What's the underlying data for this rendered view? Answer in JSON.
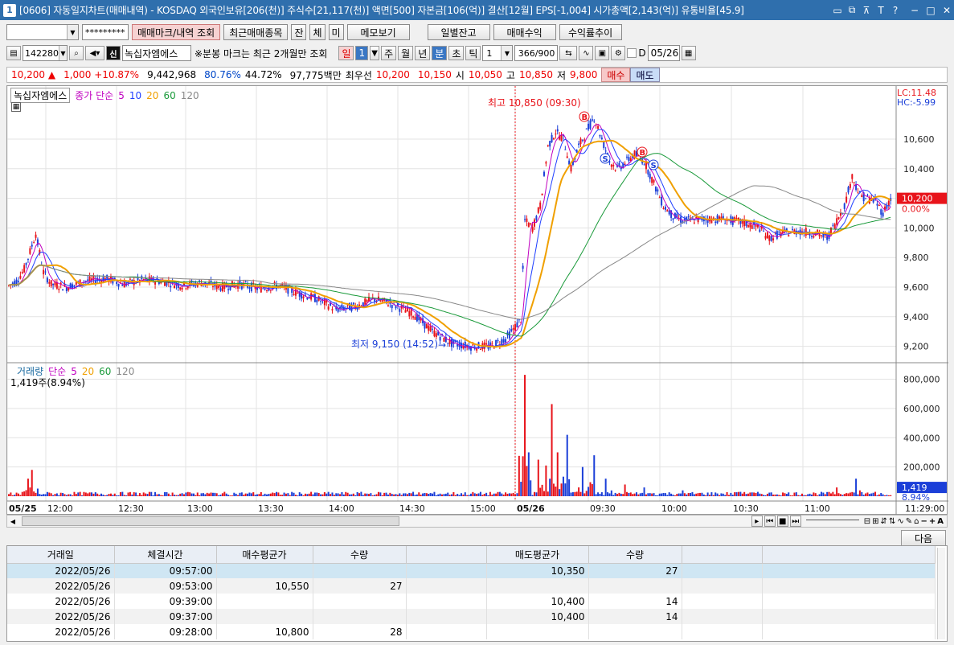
{
  "window": {
    "number": "1",
    "title": "[0606] 자동일지차트(매매내역) - KOSDAQ 외국인보유[206(천)] 주식수[21,117(천)] 액면[500] 자본금[106(억)] 결산[12월] EPS[-1,004] 시가총액[2,143(억)] 유통비율[45.9]",
    "title_icons": [
      "▭",
      "⧉",
      "⊼",
      "T",
      "?"
    ],
    "controls": [
      "−",
      "□",
      "✕"
    ]
  },
  "toolbar1": {
    "account_value": "",
    "password_value": "*********",
    "buttons": [
      "매매마크/내역 조회",
      "최근매매종목",
      "잔",
      "체",
      "미",
      "메모보기",
      "일별잔고",
      "매매수익",
      "수익률추이"
    ]
  },
  "toolbar2": {
    "code": "142280",
    "stock_name": "녹십자엠에스",
    "mark_badge": "신",
    "notice": "※분봉 마크는 최근 2개월만 조회",
    "period_buttons": [
      "일",
      "주",
      "월",
      "년",
      "분",
      "초",
      "틱"
    ],
    "day_value": "1",
    "minute_value": "1",
    "count": "366/900",
    "date_prefix": "D",
    "date": "05/26"
  },
  "quote": {
    "price": "10,200",
    "arrow": "▲",
    "change": "1,000",
    "change_pct": "+10.87%",
    "volume": "9,442,968",
    "pct1": "80.76%",
    "pct2": "44.72%",
    "amount": "97,775백만",
    "best_label": "최우선",
    "best_ask": "10,200",
    "best_bid": "10,150",
    "open_label": "시",
    "open": "10,050",
    "high_label": "고",
    "high": "10,850",
    "low_label": "저",
    "low": "9,800",
    "buy_btn": "매수",
    "sell_btn": "매도"
  },
  "chart_data": {
    "type": "candlestick",
    "price_legend": {
      "name": "녹십자엠에스",
      "ma_label": "종가 단순",
      "periods": [
        "5",
        "10",
        "20",
        "60",
        "120"
      ]
    },
    "volume_legend": {
      "name": "거래량",
      "ma_label": "단순",
      "periods": [
        "5",
        "20",
        "60",
        "120"
      ],
      "current": "1,419주(8.94%)"
    },
    "price_axis": [
      "10,600",
      "10,400",
      "10,200",
      "10,000",
      "9,800",
      "9,600",
      "9,400",
      "9,200"
    ],
    "price_range": [
      9100,
      10850
    ],
    "volume_axis": [
      "800,000",
      "600,000",
      "400,000",
      "200,000"
    ],
    "volume_range": [
      0,
      880000
    ],
    "lc": "LC:11.48",
    "hc": "HC:-5.99",
    "current_price_tag": "10,200",
    "current_pct_tag": "0.00%",
    "current_vol_tag": "1,419",
    "current_vol_pct_tag": "8.94%",
    "high_annotation": "최고 10,850 (09:30)",
    "low_annotation": "최저 9,150 (14:52)",
    "x_labels": [
      "05/25",
      "12:00",
      "12:30",
      "13:00",
      "13:30",
      "14:00",
      "14:30",
      "15:00",
      "05/26",
      "09:30",
      "10:00",
      "10:30",
      "11:00"
    ],
    "x_end_label": "11:29:00",
    "markers": [
      "B",
      "S",
      "B",
      "S"
    ],
    "price_path_points": [
      [
        0,
        9610
      ],
      [
        4,
        9640
      ],
      [
        8,
        9720
      ],
      [
        12,
        9880
      ],
      [
        14,
        9960
      ],
      [
        18,
        9700
      ],
      [
        22,
        9620
      ],
      [
        30,
        9600
      ],
      [
        40,
        9640
      ],
      [
        50,
        9660
      ],
      [
        60,
        9620
      ],
      [
        70,
        9650
      ],
      [
        80,
        9640
      ],
      [
        90,
        9610
      ],
      [
        100,
        9630
      ],
      [
        110,
        9600
      ],
      [
        120,
        9620
      ],
      [
        130,
        9590
      ],
      [
        140,
        9610
      ],
      [
        150,
        9560
      ],
      [
        160,
        9520
      ],
      [
        170,
        9450
      ],
      [
        180,
        9470
      ],
      [
        190,
        9520
      ],
      [
        200,
        9480
      ],
      [
        210,
        9420
      ],
      [
        220,
        9300
      ],
      [
        230,
        9220
      ],
      [
        240,
        9200
      ],
      [
        250,
        9200
      ],
      [
        258,
        9250
      ],
      [
        266,
        9380
      ],
      [
        268,
        10050
      ],
      [
        272,
        10000
      ],
      [
        276,
        10150
      ],
      [
        280,
        10550
      ],
      [
        284,
        10650
      ],
      [
        288,
        10600
      ],
      [
        292,
        10400
      ],
      [
        296,
        10550
      ],
      [
        300,
        10650
      ],
      [
        304,
        10750
      ],
      [
        308,
        10600
      ],
      [
        312,
        10450
      ],
      [
        316,
        10400
      ],
      [
        320,
        10440
      ],
      [
        325,
        10500
      ],
      [
        330,
        10450
      ],
      [
        335,
        10300
      ],
      [
        340,
        10150
      ],
      [
        345,
        10080
      ],
      [
        350,
        10050
      ],
      [
        360,
        10060
      ],
      [
        370,
        10060
      ],
      [
        380,
        10040
      ],
      [
        390,
        10000
      ],
      [
        395,
        9930
      ],
      [
        400,
        9960
      ],
      [
        410,
        9980
      ],
      [
        420,
        9960
      ],
      [
        425,
        9930
      ],
      [
        430,
        10050
      ],
      [
        434,
        10150
      ],
      [
        438,
        10350
      ],
      [
        442,
        10220
      ],
      [
        446,
        10200
      ],
      [
        450,
        10180
      ],
      [
        454,
        10100
      ],
      [
        458,
        10200
      ]
    ],
    "volume_spikes": [
      [
        10,
        120000
      ],
      [
        12,
        180000
      ],
      [
        100,
        20000
      ],
      [
        210,
        30000
      ],
      [
        266,
        60000
      ],
      [
        268,
        830000
      ],
      [
        270,
        300000
      ],
      [
        275,
        250000
      ],
      [
        282,
        630000
      ],
      [
        285,
        300000
      ],
      [
        290,
        420000
      ],
      [
        298,
        200000
      ],
      [
        304,
        280000
      ],
      [
        310,
        120000
      ],
      [
        320,
        80000
      ],
      [
        330,
        60000
      ],
      [
        350,
        40000
      ],
      [
        380,
        30000
      ],
      [
        430,
        60000
      ],
      [
        440,
        120000
      ],
      [
        450,
        30000
      ]
    ]
  },
  "bottom_toolbar": {
    "icons": [
      "▸",
      "⏮",
      "■",
      "⏭",
      "⊟",
      "⊞",
      "⇵",
      "⇅",
      "∿",
      "✎",
      "⌂",
      "−",
      "+",
      "A"
    ]
  },
  "trades": {
    "next_btn": "다음",
    "headers": [
      "거래일",
      "체결시간",
      "매수평균가",
      "수량",
      "",
      "매도평균가",
      "수량",
      "",
      ""
    ],
    "rows": [
      [
        "2022/05/26",
        "09:57:00",
        "",
        "",
        "",
        "10,350",
        "27",
        "",
        ""
      ],
      [
        "2022/05/26",
        "09:53:00",
        "10,550",
        "27",
        "",
        "",
        "",
        "",
        ""
      ],
      [
        "2022/05/26",
        "09:39:00",
        "",
        "",
        "",
        "10,400",
        "14",
        "",
        ""
      ],
      [
        "2022/05/26",
        "09:37:00",
        "",
        "",
        "",
        "10,400",
        "14",
        "",
        ""
      ],
      [
        "2022/05/26",
        "09:28:00",
        "10,800",
        "28",
        "",
        "",
        "",
        "",
        ""
      ]
    ]
  },
  "colors": {
    "up": "#e8141b",
    "down": "#1b3fd8",
    "ma5": "#c000c0",
    "ma10": "#1f3fff",
    "ma20": "#f0a000",
    "ma60": "#1a9a3a",
    "ma120": "#888888"
  }
}
